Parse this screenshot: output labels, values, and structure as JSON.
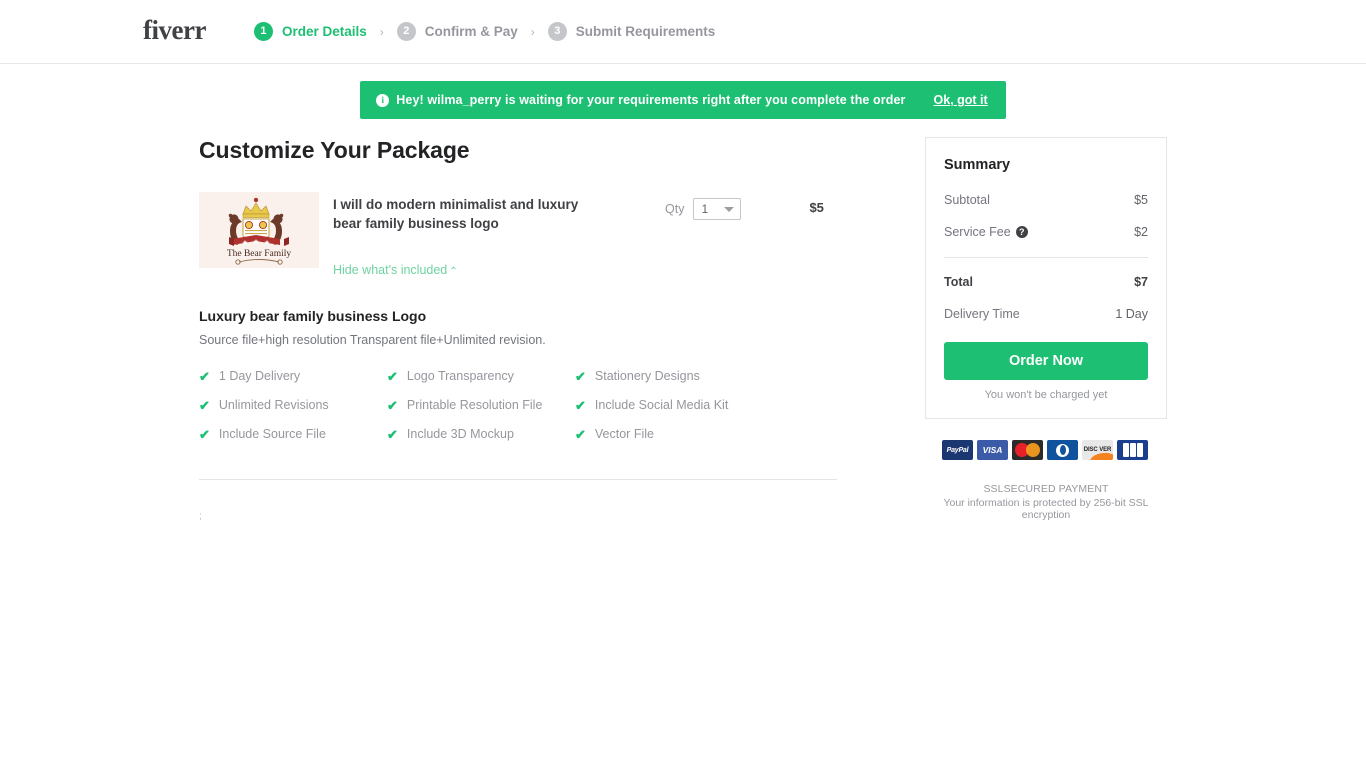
{
  "header": {
    "brand": "fiverr",
    "steps": [
      {
        "num": "1",
        "label": "Order Details",
        "state": "active"
      },
      {
        "num": "2",
        "label": "Confirm & Pay",
        "state": "inactive"
      },
      {
        "num": "3",
        "label": "Submit Requirements",
        "state": "inactive"
      }
    ],
    "separator": "›"
  },
  "notice": {
    "icon": "info-icon",
    "glyph": "i",
    "text": "Hey! wilma_perry is waiting for your requirements right after you complete the order",
    "cta": "Ok, got it",
    "color": "#1dbf73"
  },
  "main": {
    "page_title": "Customize Your Package",
    "gig": {
      "thumb_caption": "The Bear Family",
      "title": "I will do modern minimalist and luxury bear family business logo",
      "toggle_label": "Hide what's included",
      "toggle_chevron": "⌃",
      "qty_label": "Qty",
      "qty_value": "1",
      "price": "$5"
    },
    "package": {
      "title": "Luxury bear family business Logo",
      "description": "Source file+high resolution Transparent file+Unlimited revision.",
      "check_glyph": "✔",
      "features": [
        "1 Day Delivery",
        "Logo Transparency",
        "Stationery Designs",
        "Unlimited Revisions",
        "Printable Resolution File",
        "Include Social Media Kit",
        "Include Source File",
        "Include 3D Mockup",
        "Vector File"
      ]
    },
    "artifact": ";"
  },
  "summary": {
    "title": "Summary",
    "rows": [
      {
        "label": "Subtotal",
        "value": "$5",
        "help": false
      },
      {
        "label": "Service Fee",
        "value": "$2",
        "help": true
      }
    ],
    "help_glyph": "?",
    "total": {
      "label": "Total",
      "value": "$7"
    },
    "delivery": {
      "label": "Delivery Time",
      "value": "1 Day"
    },
    "order_button": "Order Now",
    "charge_note": "You won't be charged yet",
    "payments": [
      {
        "name": "paypal-icon",
        "label": "PayPal"
      },
      {
        "name": "visa-icon",
        "label": "VISA"
      },
      {
        "name": "mastercard-icon",
        "label": ""
      },
      {
        "name": "diners-club-icon",
        "label": ""
      },
      {
        "name": "discover-icon",
        "label": "DISC VER"
      },
      {
        "name": "jcb-icon",
        "label": ""
      }
    ],
    "ssl_line1": "SSLSECURED PAYMENT",
    "ssl_line2": "Your information is protected by 256-bit SSL encryption"
  }
}
